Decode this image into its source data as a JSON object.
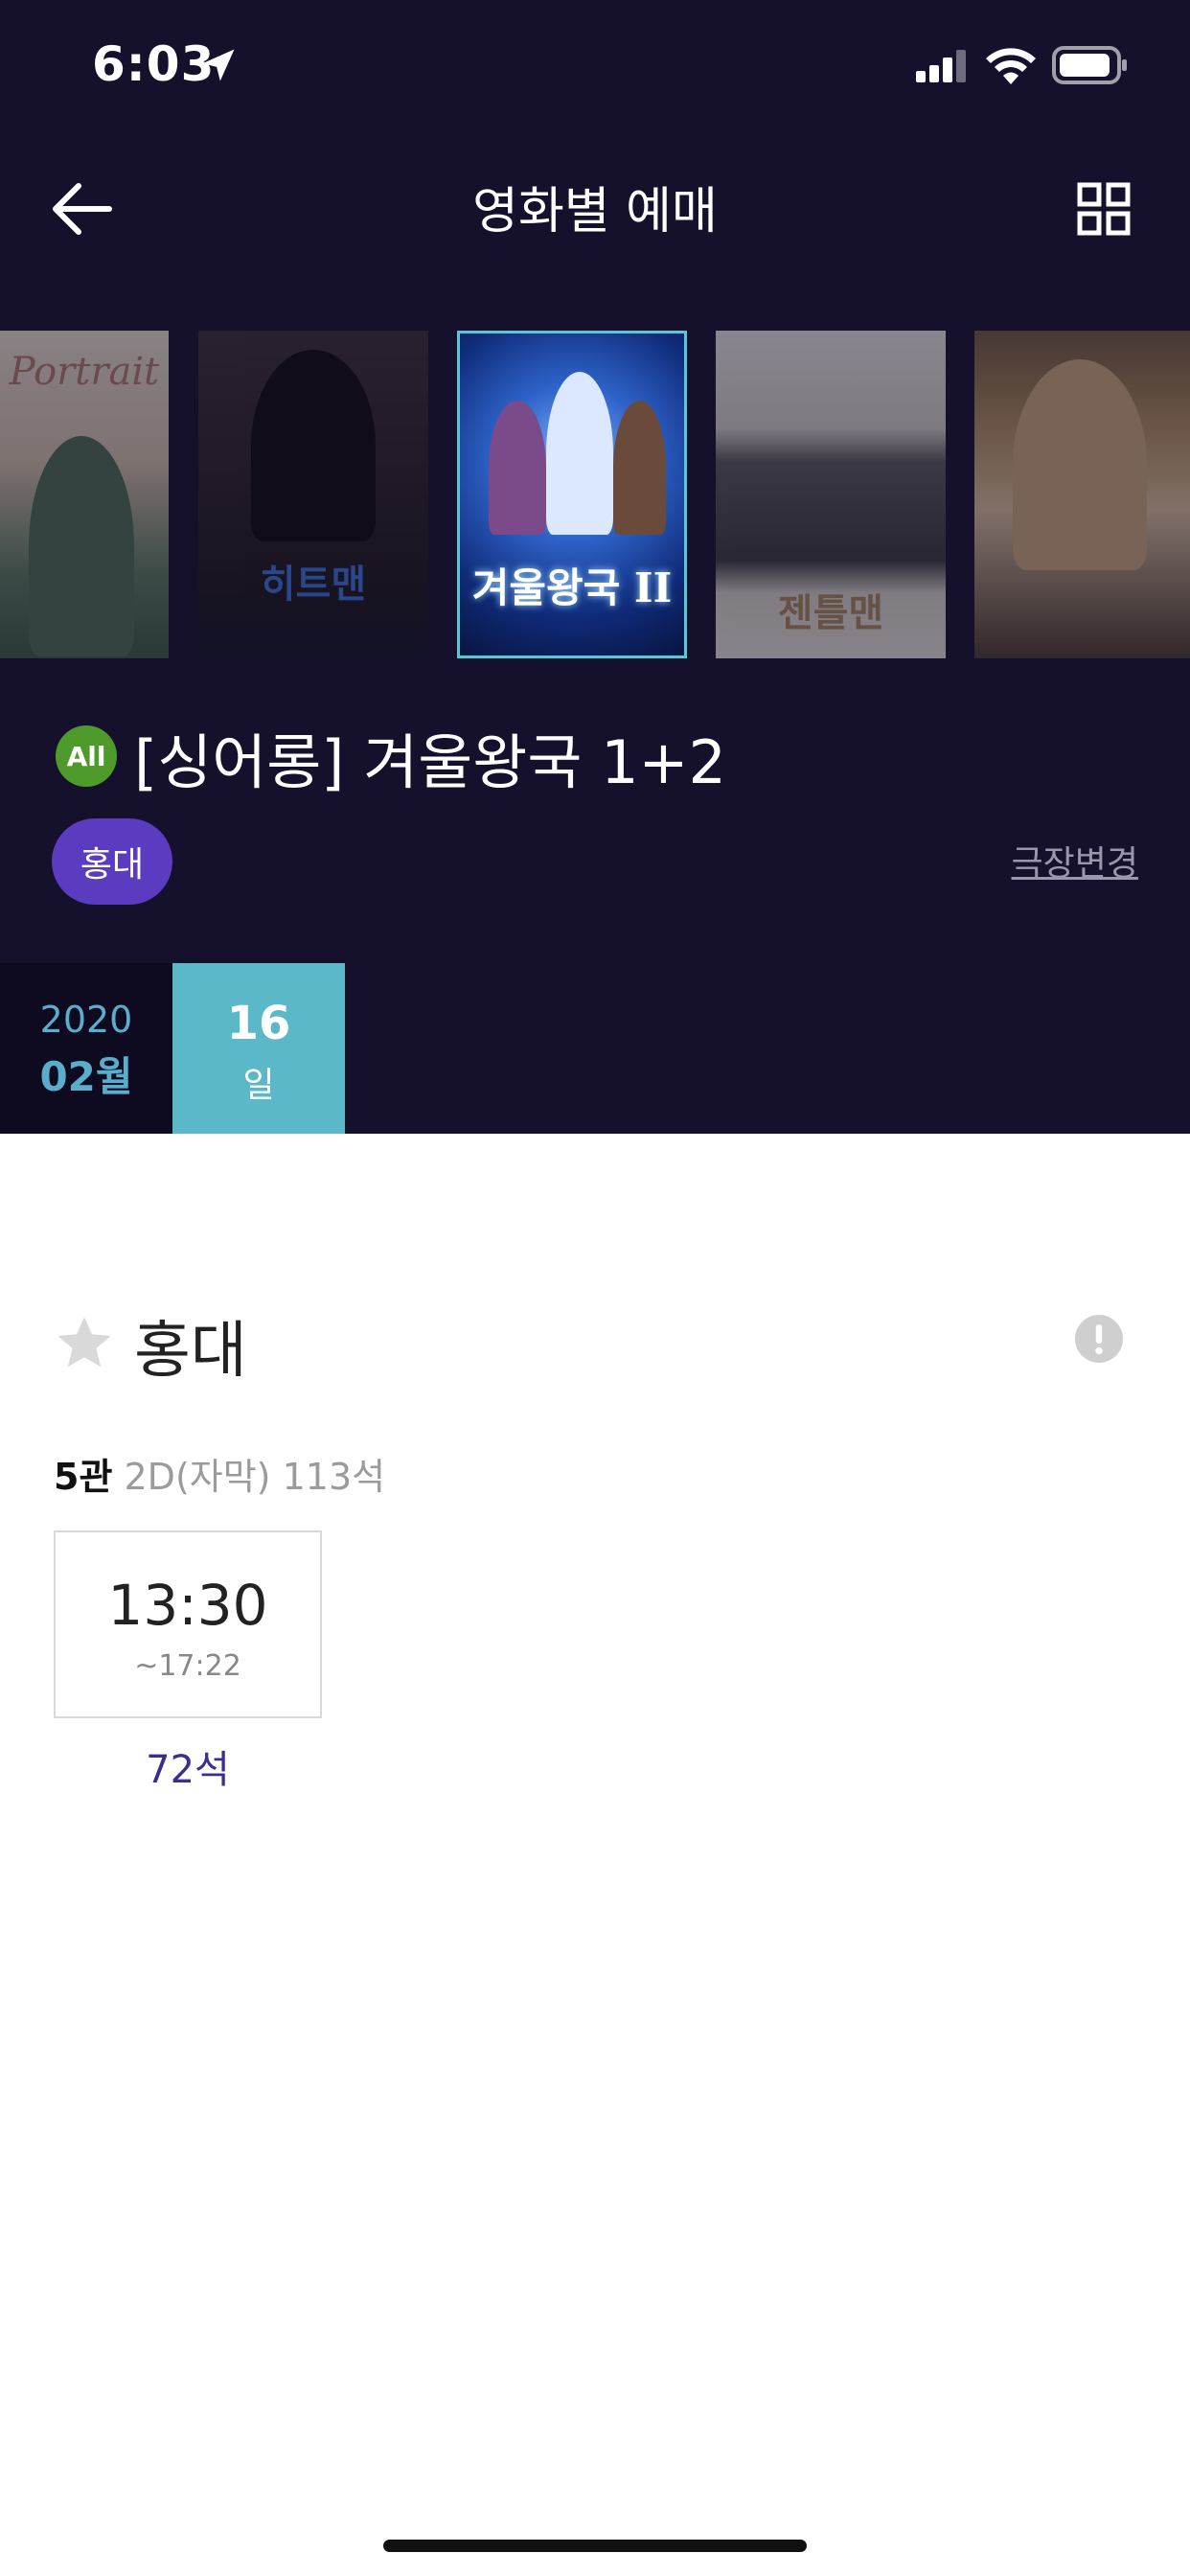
{
  "status_bar": {
    "time": "6:03"
  },
  "nav": {
    "title": "영화별 예매"
  },
  "posters": [
    {
      "caption": "Portrait"
    },
    {
      "caption": "히트맨"
    },
    {
      "caption": "겨울왕국 II",
      "selected": true
    },
    {
      "caption": "젠틀맨"
    },
    {
      "caption": ""
    }
  ],
  "movie": {
    "age_rating": "All",
    "title": "[싱어롱] 겨울왕국 1+2"
  },
  "theater_chip": "홍대",
  "change_theater_label": "극장변경",
  "date": {
    "year": "2020",
    "month": "02월",
    "day": "16",
    "day_unit": "일"
  },
  "theater": {
    "name": "홍대",
    "screen_no": "5관",
    "screen_detail": "2D(자막) 113석",
    "showtimes": [
      {
        "start": "13:30",
        "end": "~17:22",
        "seats": "72석"
      }
    ]
  },
  "colors": {
    "header_bg": "#15102b",
    "accent_purple": "#5b3bbf",
    "date_selected": "#5ab8c8",
    "rating_green": "#4e9a2a"
  }
}
